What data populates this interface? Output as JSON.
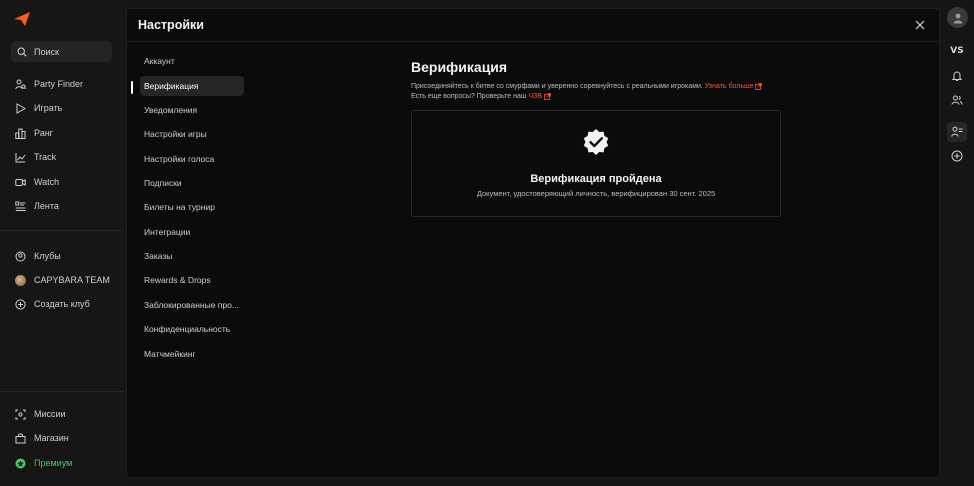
{
  "sidebar": {
    "search_label": "Поиск",
    "nav": [
      {
        "label": "Party Finder",
        "icon": "party-finder-icon"
      },
      {
        "label": "Играть",
        "icon": "play-icon"
      },
      {
        "label": "Ранг",
        "icon": "rank-icon"
      },
      {
        "label": "Track",
        "icon": "track-icon"
      },
      {
        "label": "Watch",
        "icon": "watch-icon"
      },
      {
        "label": "Лента",
        "icon": "feed-icon"
      }
    ],
    "clubs": [
      {
        "label": "Клубы",
        "icon": "clubs-icon"
      },
      {
        "label": "CAPYBARA TEAM",
        "icon": "club-avatar"
      },
      {
        "label": "Создать клуб",
        "icon": "add-circle-icon"
      }
    ],
    "bottom": [
      {
        "label": "Миссии",
        "icon": "missions-icon"
      },
      {
        "label": "Магазин",
        "icon": "shop-icon"
      },
      {
        "label": "Премиум",
        "icon": "premium-icon"
      }
    ]
  },
  "rail": {
    "vs_label": "VS"
  },
  "modal": {
    "title": "Настройки",
    "menu": [
      "Аккаунт",
      "Верификация",
      "Уведомления",
      "Настройки игры",
      "Настройки голоса",
      "Подписки",
      "Билеты на турнир",
      "Интеграции",
      "Заказы",
      "Rewards & Drops",
      "Заблокированные про...",
      "Конфиденциальность",
      "Матчмейкинг"
    ],
    "active_index": 1
  },
  "content": {
    "title": "Верификация",
    "desc_line1": "Присоединяйтесь к битве со смурфами и уверенно соревнуйтесь с реальными игроками.",
    "learn_more": "Узнать больше",
    "desc_line2": "Есть еще вопросы? Проверьте наш",
    "faq_link": "ЧЗВ",
    "card_title": "Верификация пройдена",
    "card_sub": "Документ, удостоверяющий личность, верифицирован 30 сент. 2025"
  },
  "colors": {
    "accent": "#ff5a1f",
    "premium": "#3ecf5c",
    "background": "#0b0b0b"
  }
}
